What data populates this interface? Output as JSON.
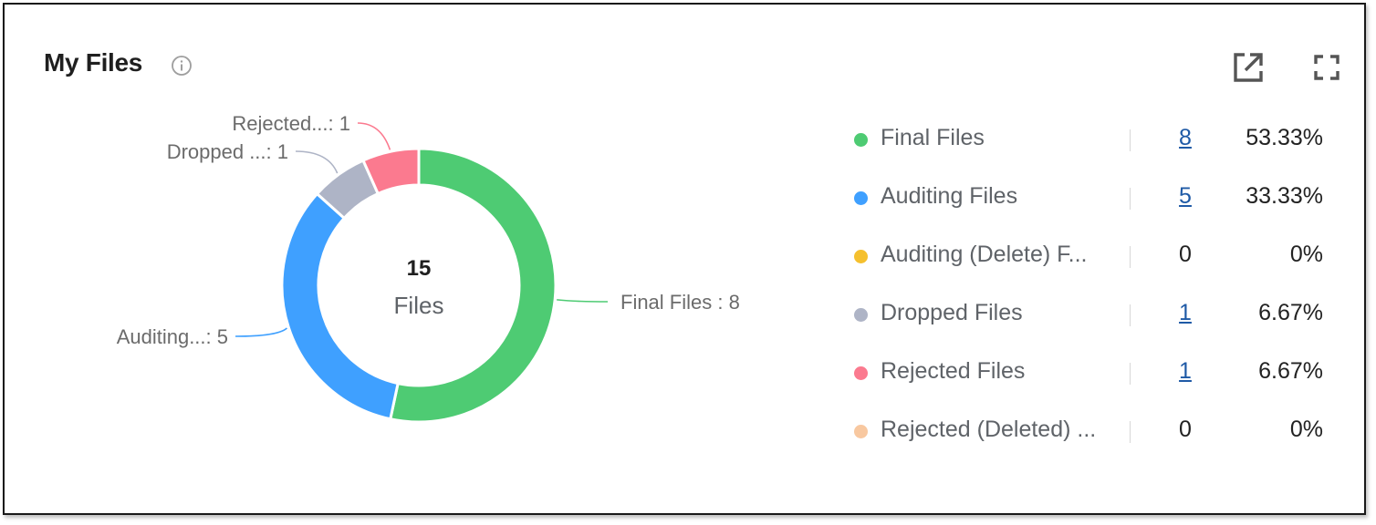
{
  "widget": {
    "title": "My Files",
    "info_icon": "info-icon",
    "open_icon": "open-in-new-icon",
    "fullscreen_icon": "fullscreen-icon"
  },
  "chart_data": {
    "type": "pie",
    "center_value": "15",
    "center_label": "Files",
    "slices": [
      {
        "label": "Final Files  : 8",
        "value": 8,
        "color": "#4ecb73"
      },
      {
        "label": "Auditing...: 5",
        "value": 5,
        "color": "#3fa0ff"
      },
      {
        "label": "Dropped ...: 1",
        "value": 1,
        "color": "#aeb4c6"
      },
      {
        "label": "Rejected...: 1",
        "value": 1,
        "color": "#fb7a8f"
      }
    ]
  },
  "legend": [
    {
      "name": "Final Files",
      "count": "8",
      "percent": "53.33%",
      "color": "#4ecb73",
      "link": true
    },
    {
      "name": "Auditing Files",
      "count": "5",
      "percent": "33.33%",
      "color": "#3fa0ff",
      "link": true
    },
    {
      "name": "Auditing (Delete) F...",
      "count": "0",
      "percent": "0%",
      "color": "#f5c02e",
      "link": false
    },
    {
      "name": "Dropped Files",
      "count": "1",
      "percent": "6.67%",
      "color": "#aeb4c6",
      "link": true
    },
    {
      "name": "Rejected Files",
      "count": "1",
      "percent": "6.67%",
      "color": "#fb7a8f",
      "link": true
    },
    {
      "name": "Rejected (Deleted) ...",
      "count": "0",
      "percent": "0%",
      "color": "#f8c8a0",
      "link": false
    }
  ]
}
